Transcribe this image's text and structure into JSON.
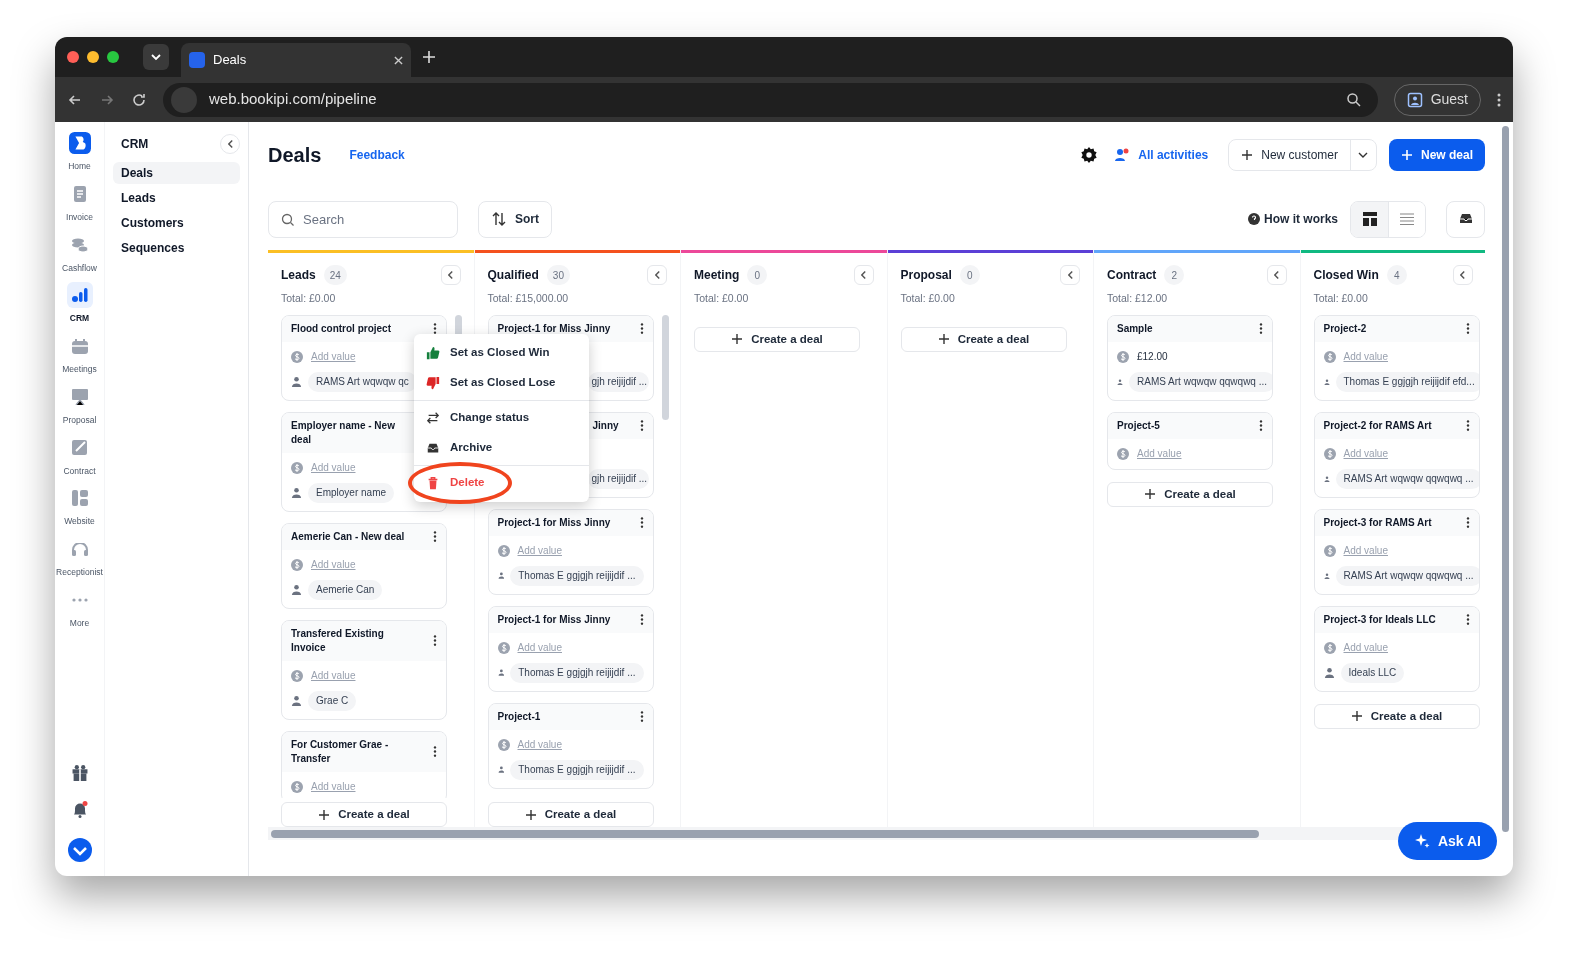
{
  "browser": {
    "tab_title": "Deals",
    "url": "web.bookipi.com/pipeline",
    "profile": "Guest"
  },
  "rail": {
    "items": [
      {
        "label": "Home",
        "kind": "logo",
        "selected": false
      },
      {
        "label": "Invoice",
        "kind": "invoice",
        "selected": false
      },
      {
        "label": "Cashflow",
        "kind": "cashflow",
        "selected": false
      },
      {
        "label": "CRM",
        "kind": "crm",
        "selected": true
      },
      {
        "label": "Meetings",
        "kind": "meetings",
        "selected": false
      },
      {
        "label": "Proposal",
        "kind": "proposal",
        "selected": false
      },
      {
        "label": "Contract",
        "kind": "contract",
        "selected": false
      },
      {
        "label": "Website",
        "kind": "website",
        "selected": false
      },
      {
        "label": "Receptionist",
        "kind": "receptionist",
        "selected": false
      },
      {
        "label": "More",
        "kind": "more",
        "selected": false
      }
    ]
  },
  "sidebar": {
    "title": "CRM",
    "items": [
      {
        "label": "Deals",
        "selected": true
      },
      {
        "label": "Leads",
        "selected": false
      },
      {
        "label": "Customers",
        "selected": false
      },
      {
        "label": "Sequences",
        "selected": false
      }
    ]
  },
  "header": {
    "title": "Deals",
    "feedback": "Feedback",
    "activities": "All activities",
    "new_customer": "New customer",
    "new_deal": "New deal"
  },
  "toolbar": {
    "search_placeholder": "Search",
    "sort": "Sort",
    "help": "How it works",
    "views": [
      {
        "kind": "board",
        "selected": true
      },
      {
        "kind": "list",
        "selected": false
      }
    ]
  },
  "columns": [
    {
      "name": "Leads",
      "count": "24",
      "total": "Total: £0.00",
      "color": "#fbbf24",
      "scrollable": true,
      "create": "Create a deal",
      "cards": [
        {
          "title": "Flood control project",
          "kind": "add",
          "value": "Add value",
          "contact": "RAMS Art wqwqw qc"
        },
        {
          "title": "Employer name - New deal",
          "kind": "add",
          "value": "Add value",
          "contact": "Employer name"
        },
        {
          "title": "Aemerie Can - New deal",
          "kind": "add",
          "value": "Add value",
          "contact": "Aemerie Can"
        },
        {
          "title": "Transfered Existing Invoice",
          "kind": "add",
          "value": "Add value",
          "contact": "Grae C"
        },
        {
          "title": "For Customer Grae - Transfer",
          "kind": "add",
          "value": "Add value"
        }
      ]
    },
    {
      "name": "Qualified",
      "count": "30",
      "total": "Total: £15,000.00",
      "color": "#f4511e",
      "scrollable": true,
      "create": "Create a deal",
      "cards": [
        {
          "title": "Project-1 for Miss Jinny",
          "kind": "covered",
          "contact": "gjh reijijdif ..."
        },
        {
          "title": "Jinny",
          "kind": "hidden",
          "contact": "gjh reijijdif ..."
        },
        {
          "title": "Project-1 for Miss Jinny",
          "kind": "add",
          "value": "Add value",
          "contact": "Thomas E ggjgjh reijijdif ..."
        },
        {
          "title": "Project-1 for Miss Jinny",
          "kind": "add",
          "value": "Add value",
          "contact": "Thomas E ggjgjh reijijdif ..."
        },
        {
          "title": "Project-1",
          "kind": "add",
          "value": "Add value",
          "contact": "Thomas E ggjgjh reijijdif ..."
        }
      ]
    },
    {
      "name": "Meeting",
      "count": "0",
      "total": "Total: £0.00",
      "color": "#ec4899",
      "scrollable": false,
      "create": "Create a deal"
    },
    {
      "name": "Proposal",
      "count": "0",
      "total": "Total: £0.00",
      "color": "#5b3fd6",
      "scrollable": false,
      "create": "Create a deal"
    },
    {
      "name": "Contract",
      "count": "2",
      "total": "Total: £12.00",
      "color": "#60a5fa",
      "scrollable": false,
      "create": "Create a deal",
      "cards": [
        {
          "title": "Sample",
          "kind": "amount",
          "value": "£12.00",
          "contact": "RAMS Art wqwqw qqwqwq ..."
        },
        {
          "title": "Project-5",
          "kind": "add",
          "value": "Add value"
        }
      ]
    },
    {
      "name": "Closed Win",
      "count": "4",
      "total": "Total: £0.00",
      "color": "#10b981",
      "scrollable": false,
      "create": "Create a deal",
      "cards": [
        {
          "title": "Project-2",
          "kind": "add",
          "value": "Add value",
          "contact": "Thomas E ggjgjh reijijdif efd..."
        },
        {
          "title": "Project-2 for RAMS Art",
          "kind": "add",
          "value": "Add value",
          "contact": "RAMS Art wqwqw qqwqwq ..."
        },
        {
          "title": "Project-3 for RAMS Art",
          "kind": "add",
          "value": "Add value",
          "contact": "RAMS Art wqwqw qqwqwq ..."
        },
        {
          "title": "Project-3 for Ideals LLC",
          "kind": "add",
          "value": "Add value",
          "contact": "Ideals LLC"
        }
      ]
    }
  ],
  "menu": {
    "items": [
      {
        "label": "Set as Closed Win",
        "kind": "win",
        "circled": false
      },
      {
        "label": "Set as Closed Lose",
        "kind": "lose",
        "circled": false
      },
      {
        "label": "Change status",
        "kind": "status",
        "circled": false
      },
      {
        "label": "Archive",
        "kind": "archive",
        "circled": false
      },
      {
        "label": "Delete",
        "kind": "delete",
        "circled": true
      }
    ]
  },
  "ask_ai": "Ask AI"
}
